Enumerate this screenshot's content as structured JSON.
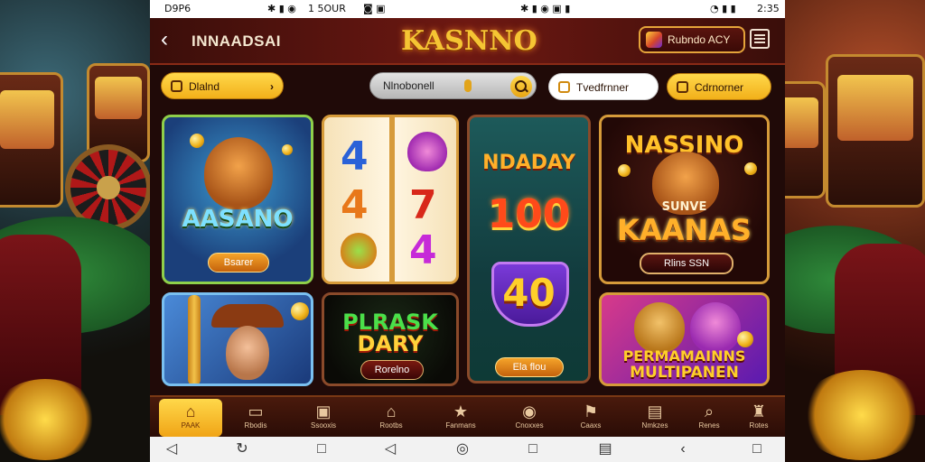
{
  "status_bar": {
    "left_time": "D9P6",
    "center_left": "1 5OUR",
    "right_time": "2:35"
  },
  "app_bar": {
    "title": "INNAADSAI",
    "logo": "KASNNO",
    "reward_label": "Rubndo ACY"
  },
  "filters": {
    "category_label": "Dlalnd",
    "search_placeholder": "Nlnobonell",
    "chip_one": "Tvedfrnner",
    "chip_two": "Cdrnorner"
  },
  "games": [
    {
      "title": "AASANO",
      "button": "Bsarer"
    },
    {
      "title": "",
      "reel_symbols": [
        "4",
        "4",
        "7",
        "4"
      ]
    },
    {
      "title": "NDADAY",
      "big_number": "100",
      "badge": "40",
      "button": "Ela flou"
    },
    {
      "title": "NASSINO",
      "subtitle": "SUNVE",
      "title2": "KAANAS",
      "button": "Rlins SSN"
    },
    {
      "title": ""
    },
    {
      "title": "PLRASK",
      "title2": "DARY",
      "button": "Rorelno"
    },
    {
      "title": "PERMAMAINNS",
      "title2": "MULTIPANEN"
    }
  ],
  "bottom_nav": [
    {
      "label": "PAAK",
      "icon": "home-icon"
    },
    {
      "label": "Rbodis",
      "icon": "cards-icon"
    },
    {
      "label": "Ssooxis",
      "icon": "slot-icon"
    },
    {
      "label": "Rootbs",
      "icon": "house-icon"
    },
    {
      "label": "Fanmans",
      "icon": "star-icon"
    },
    {
      "label": "Cnoxxes",
      "icon": "chip-icon"
    },
    {
      "label": "Caaxs",
      "icon": "flag-icon"
    },
    {
      "label": "Nmkzes",
      "icon": "ticket-icon"
    },
    {
      "label": "Renes",
      "icon": "search-icon"
    },
    {
      "label": "Rotes",
      "icon": "trophy-icon"
    }
  ],
  "colors": {
    "accent": "#f5c533",
    "appbar": "#6e1812",
    "tile_border": "#d69b3a"
  }
}
